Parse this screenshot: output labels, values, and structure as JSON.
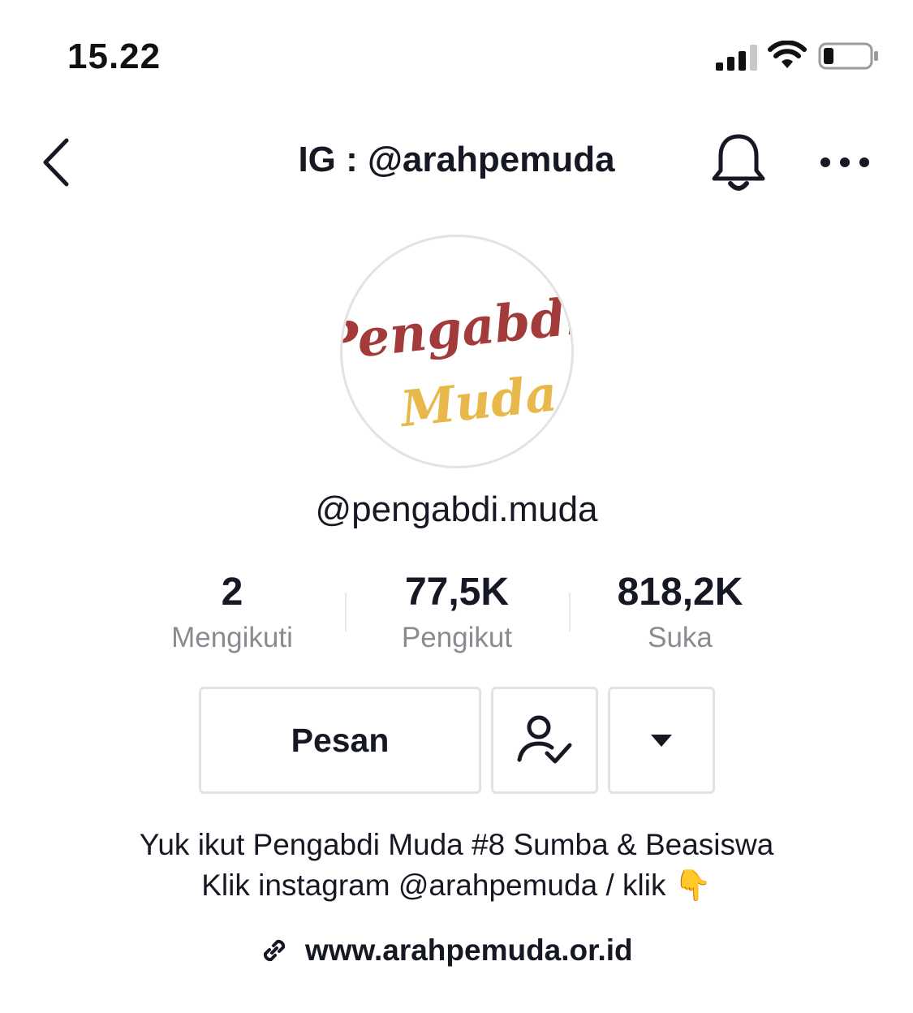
{
  "status_bar": {
    "time": "15.22",
    "icons": [
      "signal-icon",
      "wifi-icon",
      "battery-icon"
    ],
    "battery_level": 0.2
  },
  "nav": {
    "title": "IG : @arahpemuda",
    "icons": [
      "chevron-left-icon",
      "bell-icon",
      "more-icon"
    ]
  },
  "profile": {
    "avatar_text_line1": "Pengabdi",
    "avatar_text_line2": "Muda",
    "avatar_colors": {
      "line1": "#a33b3b",
      "line2": "#e8b94a"
    },
    "username": "@pengabdi.muda"
  },
  "stats": [
    {
      "value": "2",
      "label": "Mengikuti"
    },
    {
      "value": "77,5K",
      "label": "Pengikut"
    },
    {
      "value": "818,2K",
      "label": "Suka"
    }
  ],
  "actions": {
    "message_label": "Pesan",
    "icons": [
      "user-check-icon",
      "caret-down-icon"
    ]
  },
  "bio": {
    "line1": "Yuk ikut Pengabdi Muda #8 Sumba & Beasiswa",
    "line2": "Klik instagram @arahpemuda / klik 👇",
    "link": "www.arahpemuda.or.id"
  },
  "colors": {
    "text_primary": "#161823",
    "text_secondary": "#8a8b91",
    "border": "#e3e3e4"
  }
}
